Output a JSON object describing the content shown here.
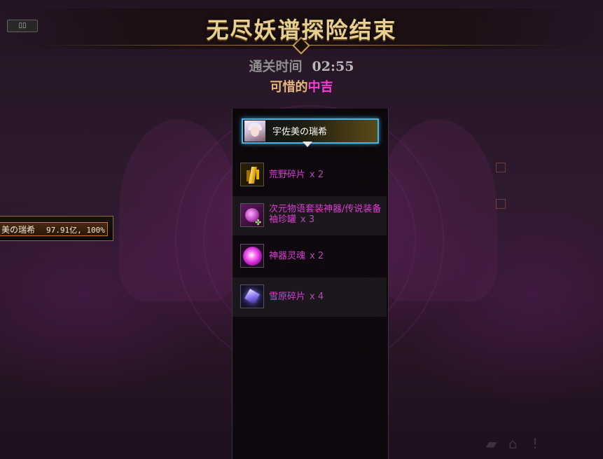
{
  "header": {
    "title": "无尽妖谱探险结束",
    "clear_time_label": "通关时间",
    "clear_time_value": "02:55",
    "result_prefix": "可惜的",
    "result_rank": "中吉"
  },
  "player": {
    "name": "宇佐美の瑞希"
  },
  "rewards": [
    {
      "name": "荒野碎片",
      "qty": "x 2",
      "icon": "gold-shard-icon"
    },
    {
      "name": "次元物语套装神器/传说装备袖珍罐",
      "qty": "x 3",
      "icon": "equipment-pack-icon"
    },
    {
      "name": "神器灵魂",
      "qty": "x 2",
      "icon": "artifact-soul-icon"
    },
    {
      "name": "雪原碎片",
      "qty": "x 4",
      "icon": "snowfield-shard-icon"
    }
  ],
  "side_plate": {
    "name": "美の瑞希",
    "stats": "97.91亿, 100%"
  },
  "colors": {
    "title_gold": "#e9cf8f",
    "rank_magenta": "#ff3ad8",
    "reward_magenta": "#d93fd2",
    "highlight_blue": "#47b3e6"
  }
}
